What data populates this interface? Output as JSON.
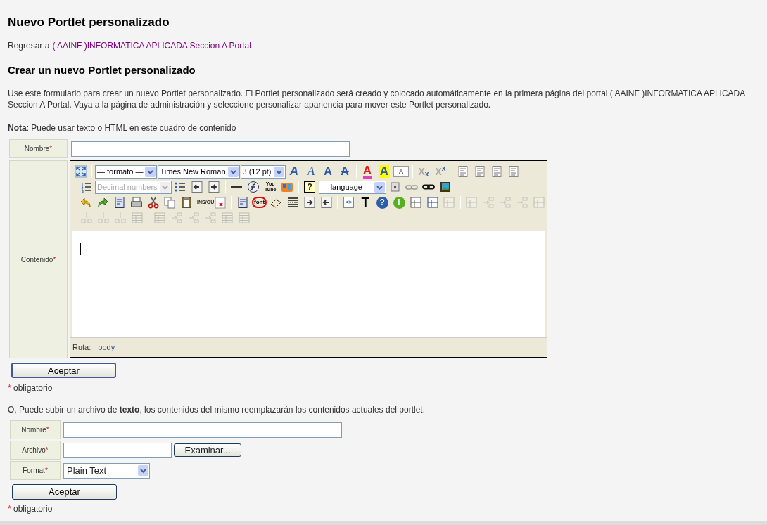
{
  "title": "Nuevo Portlet personalizado",
  "back_link": {
    "prefix": "Regresar a",
    "link": "( AAINF )INFORMATICA APLICADA Seccion A Portal"
  },
  "subtitle": "Crear un nuevo Portlet personalizado",
  "intro": "Use este formulario para crear un nuevo Portlet personalizado. El Portlet personalizado será creado y colocado automáticamente en la primera página del portal ( AAINF )INFORMATICA APLICADA Seccion A Portal. Vaya a la página de administración y seleccione personalizar apariencia para mover este Portlet personalizado.",
  "note": "**Nota**: Puede usar texto o HTML en este cuadro de contenido",
  "form": {
    "name_field": {
      "label": "Nombre",
      "required_mark": "*"
    },
    "content_field": {
      "label": "Contenido",
      "required_mark": "*"
    },
    "toolbar": [
      [
        {
          "kind": "fullscreen",
          "disabled": false
        },
        {
          "kind": "separator"
        },
        {
          "kind": "select",
          "value": "— formato —",
          "disabled": false
        },
        {
          "kind": "select",
          "value": "Times New Roman",
          "disabled": false
        },
        {
          "kind": "select",
          "value": "3 (12 pt)",
          "disabled": false
        },
        {
          "kind": "bold",
          "glyph": "A",
          "disabled": false
        },
        {
          "kind": "italic",
          "glyph": "A",
          "disabled": false
        },
        {
          "kind": "underline",
          "glyph": "A",
          "disabled": false
        },
        {
          "kind": "strikethrough",
          "glyph": "A",
          "disabled": false
        },
        {
          "kind": "separator"
        },
        {
          "kind": "text-color",
          "glyph": "A",
          "disabled": false
        },
        {
          "kind": "highlight",
          "glyph": "A",
          "disabled": false
        },
        {
          "kind": "style",
          "glyph": "A",
          "disabled": false
        },
        {
          "kind": "separator"
        },
        {
          "kind": "subscript",
          "glyph": "X$_{x}$",
          "disabled": false
        },
        {
          "kind": "superscript",
          "glyph": "X$^{x}$",
          "disabled": false
        },
        {
          "kind": "separator"
        },
        {
          "kind": "align-left",
          "disabled": false
        },
        {
          "kind": "align-center",
          "disabled": false
        },
        {
          "kind": "align-right",
          "disabled": false
        },
        {
          "kind": "justify",
          "disabled": false
        }
      ],
      [
        {
          "kind": "separator"
        },
        {
          "kind": "numbered-list",
          "disabled": false
        },
        {
          "kind": "select",
          "value": "Decimal numbers",
          "disabled": true
        },
        {
          "kind": "bullet-list",
          "disabled": false
        },
        {
          "kind": "outdent",
          "disabled": false
        },
        {
          "kind": "indent",
          "disabled": false
        },
        {
          "kind": "separator"
        },
        {
          "kind": "horizontal-rule",
          "disabled": false
        },
        {
          "kind": "flash",
          "disabled": false
        },
        {
          "kind": "youtube",
          "glyph": "You Tube",
          "disabled": false
        },
        {
          "kind": "media",
          "disabled": false
        },
        {
          "kind": "separator"
        },
        {
          "kind": "help-bubble",
          "glyph": "?",
          "disabled": false
        },
        {
          "kind": "select",
          "value": "— language —",
          "disabled": false
        },
        {
          "kind": "abbreviation",
          "disabled": false
        },
        {
          "kind": "unlink",
          "disabled": false
        },
        {
          "kind": "link",
          "disabled": false
        },
        {
          "kind": "image",
          "disabled": false
        }
      ],
      [
        {
          "kind": "separator"
        },
        {
          "kind": "undo",
          "disabled": false
        },
        {
          "kind": "redo",
          "disabled": false
        },
        {
          "kind": "document",
          "disabled": false
        },
        {
          "kind": "print",
          "disabled": false
        },
        {
          "kind": "cut",
          "disabled": false
        },
        {
          "kind": "copy",
          "disabled": false
        },
        {
          "kind": "paste",
          "disabled": false
        },
        {
          "kind": "insert-delete",
          "glyph": "INS/OU",
          "disabled": false
        },
        {
          "kind": "delete",
          "disabled": false
        },
        {
          "kind": "separator"
        },
        {
          "kind": "paste-word",
          "disabled": false
        },
        {
          "kind": "remove-font",
          "glyph": "font",
          "disabled": false
        },
        {
          "kind": "eraser",
          "disabled": false
        },
        {
          "kind": "page-break",
          "disabled": false
        },
        {
          "kind": "indent",
          "disabled": false
        },
        {
          "kind": "outdent",
          "disabled": false
        },
        {
          "kind": "separator"
        },
        {
          "kind": "source-code",
          "glyph": "<>",
          "disabled": false
        },
        {
          "kind": "text-style",
          "glyph": "T",
          "disabled": false
        },
        {
          "kind": "help",
          "glyph": "?",
          "disabled": false
        },
        {
          "kind": "info",
          "glyph": "i",
          "disabled": false
        },
        {
          "kind": "table",
          "disabled": false
        },
        {
          "kind": "table-grid",
          "disabled": false
        },
        {
          "kind": "table-cells",
          "disabled": true
        },
        {
          "kind": "separator"
        },
        {
          "kind": "table-row",
          "disabled": true
        },
        {
          "kind": "row-before",
          "disabled": true
        },
        {
          "kind": "row-after",
          "disabled": true
        },
        {
          "kind": "row-delete",
          "disabled": true
        },
        {
          "kind": "table-cells",
          "disabled": true
        }
      ],
      [
        {
          "kind": "separator"
        },
        {
          "kind": "column-before",
          "disabled": true
        },
        {
          "kind": "column-after",
          "disabled": true
        },
        {
          "kind": "column-delete",
          "disabled": true
        },
        {
          "kind": "table-row",
          "disabled": true
        },
        {
          "kind": "separator"
        },
        {
          "kind": "table-cells",
          "disabled": true
        },
        {
          "kind": "row-before",
          "disabled": true
        },
        {
          "kind": "row-after",
          "disabled": true
        },
        {
          "kind": "row-delete",
          "disabled": true
        },
        {
          "kind": "table-row",
          "disabled": true
        },
        {
          "kind": "table-cells",
          "disabled": true
        }
      ]
    ],
    "path_label": "Ruta:",
    "path_value": "body",
    "submit": "Aceptar",
    "required_note": {
      "mark": "*",
      "text": "obligatorio"
    }
  },
  "upload": {
    "intro": "O, Puede subir un archivo de **texto**, los contenidos del mismo reemplazarán los contenidos actuales del portlet.",
    "fields": [
      {
        "kind": "text",
        "label": "Nombre",
        "required_mark": "*"
      },
      {
        "kind": "file",
        "label": "Archivo",
        "required_mark": "*",
        "button": "Examinar..."
      },
      {
        "kind": "select",
        "label": "Format",
        "required_mark": "*",
        "value": "Plain Text"
      }
    ],
    "submit": "Aceptar",
    "required_note": {
      "mark": "*",
      "text": "obligatorio"
    }
  }
}
